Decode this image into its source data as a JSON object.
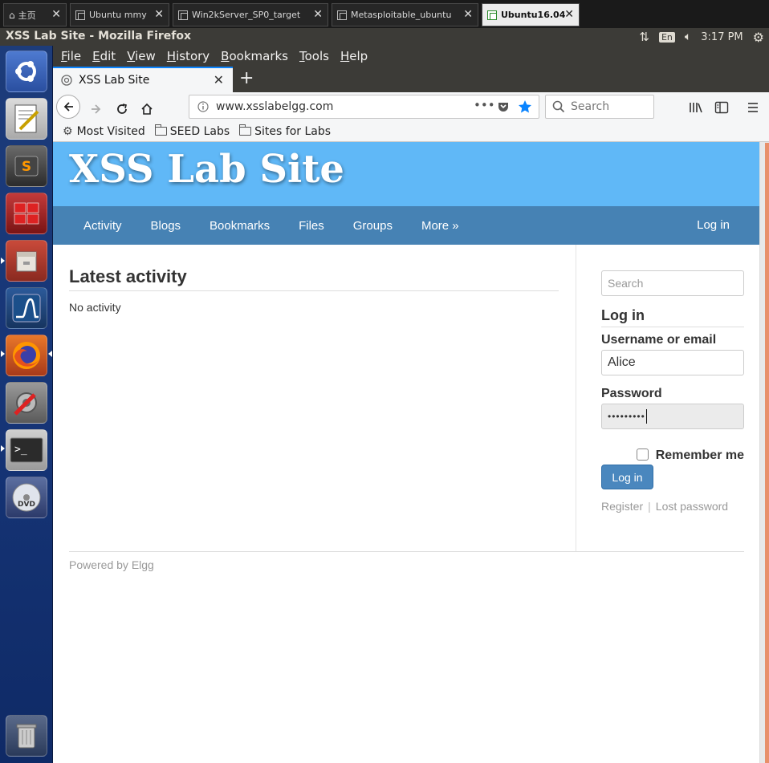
{
  "vm_tabs": [
    {
      "label": "主页",
      "active": false
    },
    {
      "label": "Ubuntu mmy",
      "active": false
    },
    {
      "label": "Win2kServer_SP0_target",
      "active": false
    },
    {
      "label": "Metasploitable_ubuntu",
      "active": false
    },
    {
      "label": "Ubuntu16.04",
      "active": true
    }
  ],
  "panel": {
    "window_title": "XSS Lab Site - Mozilla Firefox",
    "lang": "En",
    "time": "3:17 PM"
  },
  "launcher": [
    "ubuntu-dash-icon",
    "text-editor-icon",
    "sublime-icon",
    "terminal-grid-icon",
    "file-manager-icon",
    "wireshark-icon",
    "firefox-icon",
    "system-settings-icon",
    "terminal-icon",
    "dvd-icon",
    "trash-icon"
  ],
  "firefox": {
    "menus": [
      "File",
      "Edit",
      "View",
      "History",
      "Bookmarks",
      "Tools",
      "Help"
    ],
    "tab_title": "XSS Lab Site",
    "url": "www.xsslabelgg.com",
    "search_placeholder": "Search",
    "bookmarks": [
      "Most Visited",
      "SEED Labs",
      "Sites for Labs"
    ]
  },
  "site": {
    "title": "XSS Lab Site",
    "nav": [
      "Activity",
      "Blogs",
      "Bookmarks",
      "Files",
      "Groups",
      "More »"
    ],
    "login_link": "Log in",
    "main_heading": "Latest activity",
    "main_text": "No activity",
    "sidebar": {
      "search_placeholder": "Search",
      "login_heading": "Log in",
      "username_label": "Username or email",
      "username_value": "Alice",
      "password_label": "Password",
      "password_value": "•••••••••",
      "remember_label": "Remember me",
      "login_button": "Log in",
      "register_link": "Register",
      "separator": "|",
      "lost_password_link": "Lost password"
    },
    "footer": "Powered by Elgg"
  },
  "colors": {
    "header": "#60b8f7",
    "nav": "#4682b4",
    "panel": "#3c3b37",
    "accent": "#0a84ff"
  }
}
